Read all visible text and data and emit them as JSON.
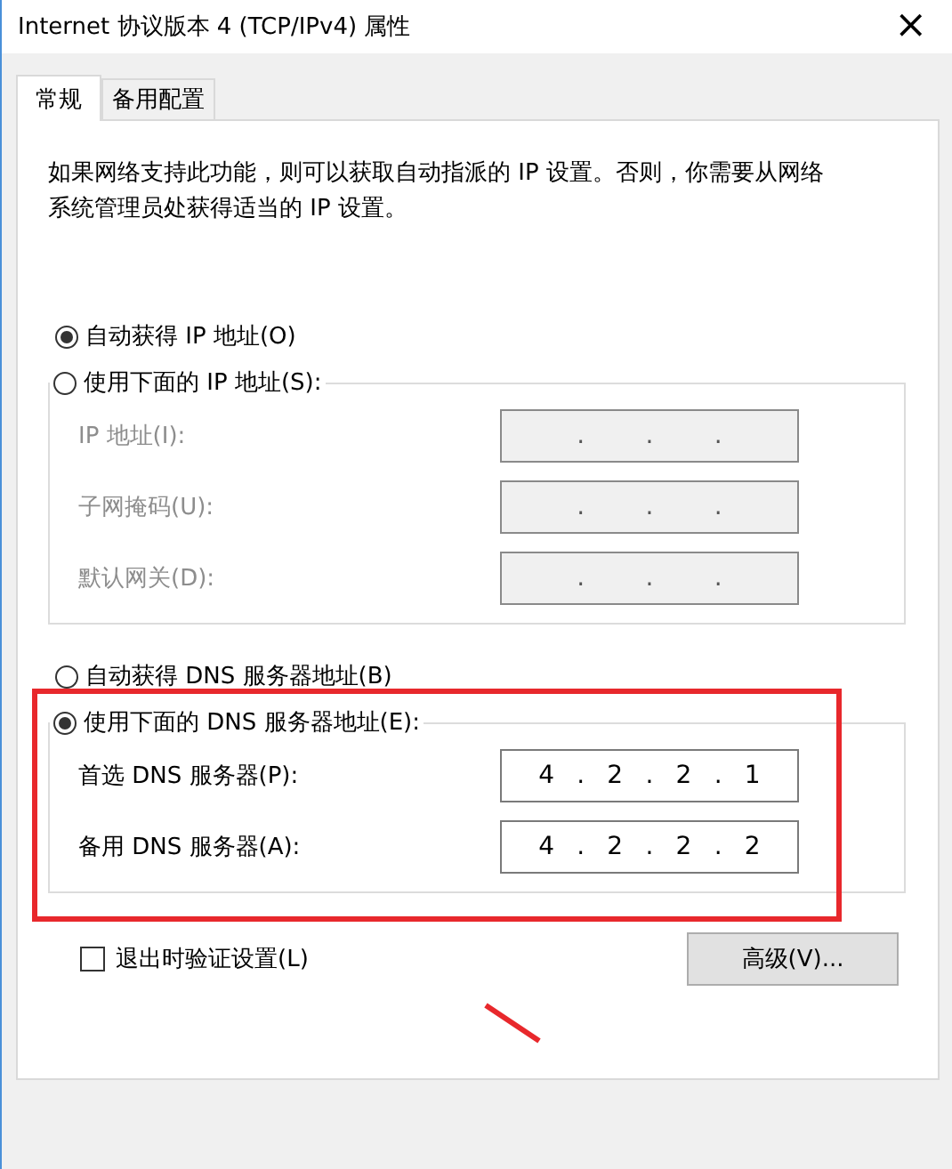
{
  "window": {
    "title": "Internet 协议版本 4 (TCP/IPv4) 属性",
    "close": "×"
  },
  "tabs": [
    {
      "label": "常规",
      "selected": true
    },
    {
      "label": "备用配置",
      "selected": false
    }
  ],
  "description": "如果网络支持此功能，则可以获取自动指派的 IP 设置。否则，你需要从网络系统管理员处获得适当的 IP 设置。",
  "ip": {
    "auto": {
      "label": "自动获得 IP 地址(O)",
      "selected": true
    },
    "manual": {
      "label": "使用下面的 IP 地址(S):",
      "selected": false
    },
    "fields": [
      {
        "label": "IP 地址(I):",
        "disabled": true,
        "separators": [
          ".",
          ".",
          "."
        ]
      },
      {
        "label": "子网掩码(U):",
        "disabled": true,
        "separators": [
          ".",
          ".",
          "."
        ]
      },
      {
        "label": "默认网关(D):",
        "disabled": true,
        "separators": [
          ".",
          ".",
          "."
        ]
      }
    ]
  },
  "dns": {
    "auto": {
      "label": "自动获得 DNS 服务器地址(B)",
      "selected": false
    },
    "manual": {
      "label": "使用下面的 DNS 服务器地址(E):",
      "selected": true
    },
    "highlighted": true,
    "fields": [
      {
        "label": "首选 DNS 服务器(P):",
        "disabled": false,
        "octets": [
          "4",
          "2",
          "2",
          "1"
        ],
        "separators": [
          ".",
          ".",
          "."
        ]
      },
      {
        "label": "备用 DNS 服务器(A):",
        "disabled": false,
        "octets": [
          "4",
          "2",
          "2",
          "2"
        ],
        "separators": [
          ".",
          ".",
          "."
        ]
      }
    ]
  },
  "validate_on_exit": {
    "label": "退出时验证设置(L)",
    "checked": false
  },
  "advanced_button": "高级(V)...",
  "pointer_arrow": true
}
